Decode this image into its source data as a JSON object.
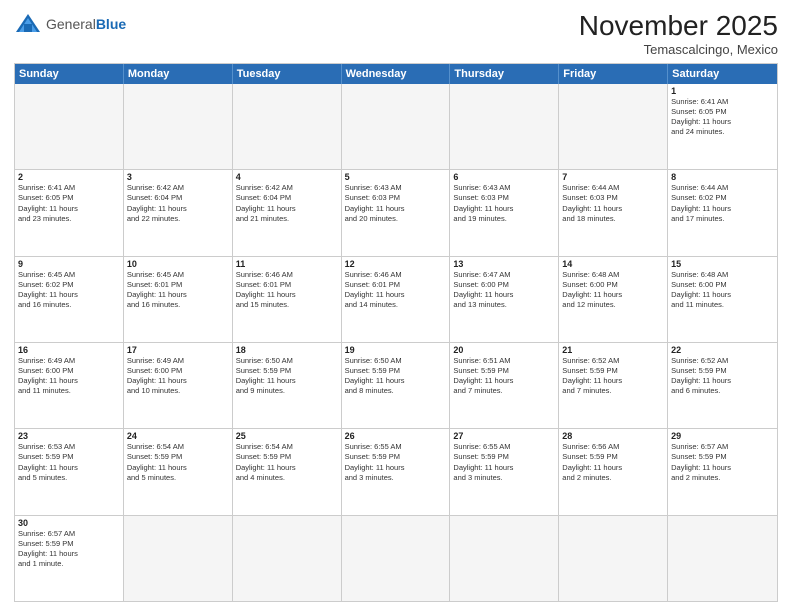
{
  "header": {
    "logo_general": "General",
    "logo_blue": "Blue",
    "month_title": "November 2025",
    "subtitle": "Temascalcingo, Mexico"
  },
  "days_of_week": [
    "Sunday",
    "Monday",
    "Tuesday",
    "Wednesday",
    "Thursday",
    "Friday",
    "Saturday"
  ],
  "rows": [
    [
      {
        "day": "",
        "text": "",
        "empty": true
      },
      {
        "day": "",
        "text": "",
        "empty": true
      },
      {
        "day": "",
        "text": "",
        "empty": true
      },
      {
        "day": "",
        "text": "",
        "empty": true
      },
      {
        "day": "",
        "text": "",
        "empty": true
      },
      {
        "day": "",
        "text": "",
        "empty": true
      },
      {
        "day": "1",
        "text": "Sunrise: 6:41 AM\nSunset: 6:05 PM\nDaylight: 11 hours\nand 24 minutes.",
        "empty": false
      }
    ],
    [
      {
        "day": "2",
        "text": "Sunrise: 6:41 AM\nSunset: 6:05 PM\nDaylight: 11 hours\nand 23 minutes.",
        "empty": false
      },
      {
        "day": "3",
        "text": "Sunrise: 6:42 AM\nSunset: 6:04 PM\nDaylight: 11 hours\nand 22 minutes.",
        "empty": false
      },
      {
        "day": "4",
        "text": "Sunrise: 6:42 AM\nSunset: 6:04 PM\nDaylight: 11 hours\nand 21 minutes.",
        "empty": false
      },
      {
        "day": "5",
        "text": "Sunrise: 6:43 AM\nSunset: 6:03 PM\nDaylight: 11 hours\nand 20 minutes.",
        "empty": false
      },
      {
        "day": "6",
        "text": "Sunrise: 6:43 AM\nSunset: 6:03 PM\nDaylight: 11 hours\nand 19 minutes.",
        "empty": false
      },
      {
        "day": "7",
        "text": "Sunrise: 6:44 AM\nSunset: 6:03 PM\nDaylight: 11 hours\nand 18 minutes.",
        "empty": false
      },
      {
        "day": "8",
        "text": "Sunrise: 6:44 AM\nSunset: 6:02 PM\nDaylight: 11 hours\nand 17 minutes.",
        "empty": false
      }
    ],
    [
      {
        "day": "9",
        "text": "Sunrise: 6:45 AM\nSunset: 6:02 PM\nDaylight: 11 hours\nand 16 minutes.",
        "empty": false
      },
      {
        "day": "10",
        "text": "Sunrise: 6:45 AM\nSunset: 6:01 PM\nDaylight: 11 hours\nand 16 minutes.",
        "empty": false
      },
      {
        "day": "11",
        "text": "Sunrise: 6:46 AM\nSunset: 6:01 PM\nDaylight: 11 hours\nand 15 minutes.",
        "empty": false
      },
      {
        "day": "12",
        "text": "Sunrise: 6:46 AM\nSunset: 6:01 PM\nDaylight: 11 hours\nand 14 minutes.",
        "empty": false
      },
      {
        "day": "13",
        "text": "Sunrise: 6:47 AM\nSunset: 6:00 PM\nDaylight: 11 hours\nand 13 minutes.",
        "empty": false
      },
      {
        "day": "14",
        "text": "Sunrise: 6:48 AM\nSunset: 6:00 PM\nDaylight: 11 hours\nand 12 minutes.",
        "empty": false
      },
      {
        "day": "15",
        "text": "Sunrise: 6:48 AM\nSunset: 6:00 PM\nDaylight: 11 hours\nand 11 minutes.",
        "empty": false
      }
    ],
    [
      {
        "day": "16",
        "text": "Sunrise: 6:49 AM\nSunset: 6:00 PM\nDaylight: 11 hours\nand 11 minutes.",
        "empty": false
      },
      {
        "day": "17",
        "text": "Sunrise: 6:49 AM\nSunset: 6:00 PM\nDaylight: 11 hours\nand 10 minutes.",
        "empty": false
      },
      {
        "day": "18",
        "text": "Sunrise: 6:50 AM\nSunset: 5:59 PM\nDaylight: 11 hours\nand 9 minutes.",
        "empty": false
      },
      {
        "day": "19",
        "text": "Sunrise: 6:50 AM\nSunset: 5:59 PM\nDaylight: 11 hours\nand 8 minutes.",
        "empty": false
      },
      {
        "day": "20",
        "text": "Sunrise: 6:51 AM\nSunset: 5:59 PM\nDaylight: 11 hours\nand 7 minutes.",
        "empty": false
      },
      {
        "day": "21",
        "text": "Sunrise: 6:52 AM\nSunset: 5:59 PM\nDaylight: 11 hours\nand 7 minutes.",
        "empty": false
      },
      {
        "day": "22",
        "text": "Sunrise: 6:52 AM\nSunset: 5:59 PM\nDaylight: 11 hours\nand 6 minutes.",
        "empty": false
      }
    ],
    [
      {
        "day": "23",
        "text": "Sunrise: 6:53 AM\nSunset: 5:59 PM\nDaylight: 11 hours\nand 5 minutes.",
        "empty": false
      },
      {
        "day": "24",
        "text": "Sunrise: 6:54 AM\nSunset: 5:59 PM\nDaylight: 11 hours\nand 5 minutes.",
        "empty": false
      },
      {
        "day": "25",
        "text": "Sunrise: 6:54 AM\nSunset: 5:59 PM\nDaylight: 11 hours\nand 4 minutes.",
        "empty": false
      },
      {
        "day": "26",
        "text": "Sunrise: 6:55 AM\nSunset: 5:59 PM\nDaylight: 11 hours\nand 3 minutes.",
        "empty": false
      },
      {
        "day": "27",
        "text": "Sunrise: 6:55 AM\nSunset: 5:59 PM\nDaylight: 11 hours\nand 3 minutes.",
        "empty": false
      },
      {
        "day": "28",
        "text": "Sunrise: 6:56 AM\nSunset: 5:59 PM\nDaylight: 11 hours\nand 2 minutes.",
        "empty": false
      },
      {
        "day": "29",
        "text": "Sunrise: 6:57 AM\nSunset: 5:59 PM\nDaylight: 11 hours\nand 2 minutes.",
        "empty": false
      }
    ],
    [
      {
        "day": "30",
        "text": "Sunrise: 6:57 AM\nSunset: 5:59 PM\nDaylight: 11 hours\nand 1 minute.",
        "empty": false
      },
      {
        "day": "",
        "text": "",
        "empty": true
      },
      {
        "day": "",
        "text": "",
        "empty": true
      },
      {
        "day": "",
        "text": "",
        "empty": true
      },
      {
        "day": "",
        "text": "",
        "empty": true
      },
      {
        "day": "",
        "text": "",
        "empty": true
      },
      {
        "day": "",
        "text": "",
        "empty": true
      }
    ]
  ]
}
